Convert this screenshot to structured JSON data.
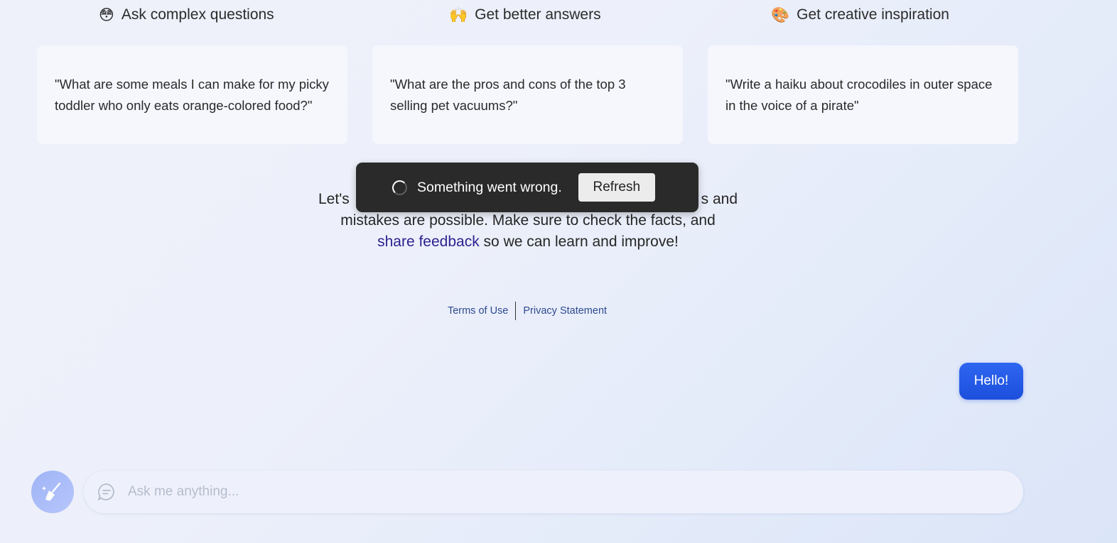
{
  "features": [
    {
      "emoji": "😳",
      "icon": "astonished-face-icon",
      "title": "Ask complex questions",
      "prompt": "\"What are some meals I can make for my picky toddler who only eats orange-colored food?\""
    },
    {
      "emoji": "🙌",
      "icon": "raised-hands-icon",
      "title": "Get better answers",
      "prompt": "\"What are the pros and cons of the top 3 selling pet vacuums?\""
    },
    {
      "emoji": "🎨",
      "icon": "palette-icon",
      "title": "Get creative inspiration",
      "prompt": "\"Write a haiku about crocodiles in outer space in the voice of a pirate\""
    }
  ],
  "disclaimer": {
    "line1_start": "Let's ",
    "line1_end": "s and",
    "line2": "mistakes are possible. Make sure to check the facts, and",
    "link": "share feedback",
    "line3_end": " so we can learn and improve!"
  },
  "legal": {
    "terms": "Terms of Use",
    "privacy": "Privacy Statement"
  },
  "toast": {
    "message": "Something went wrong.",
    "button": "Refresh"
  },
  "chat": {
    "user_message": "Hello!"
  },
  "input": {
    "placeholder": "Ask me anything...",
    "value": ""
  },
  "colors": {
    "accent": "#1c4fdc",
    "link": "#2c1f8f",
    "toast_bg": "#2a2a2a"
  }
}
